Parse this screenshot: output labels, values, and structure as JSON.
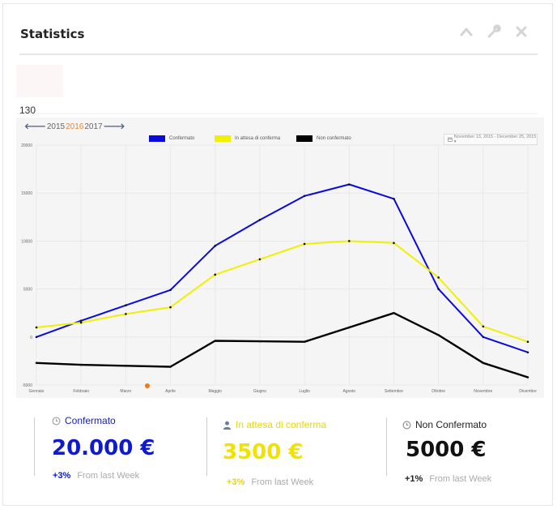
{
  "header": {
    "title": "Statistics"
  },
  "top_number": "130",
  "years": {
    "prev_arrow": "🡐",
    "y1": "2015",
    "y2": "2016",
    "y3": "2017",
    "next_arrow": "🡒"
  },
  "date_range": "November 13, 2015 - December 25, 2015 ▾",
  "legend": [
    {
      "label": "Confermato",
      "color": "#0a0adc"
    },
    {
      "label": "In attesa di conferma",
      "color": "#f0f000"
    },
    {
      "label": "Non confermato",
      "color": "#000000"
    }
  ],
  "chart_data": {
    "type": "line",
    "categories": [
      "Gennaio",
      "Febbraio",
      "Marzo",
      "Aprile",
      "Maggio",
      "Giugno",
      "Luglio",
      "Agosto",
      "Settembre",
      "Ottobre",
      "Novembre",
      "Dicembre"
    ],
    "ylim": [
      -5000,
      20000
    ],
    "y_ticks": [
      20000,
      15000,
      10000,
      5000,
      0,
      -5000
    ],
    "grid": true,
    "legend_position": "top",
    "series": [
      {
        "name": "Confermato",
        "color": "#0a0adc",
        "values": [
          0,
          1700,
          3300,
          4900,
          9500,
          12200,
          14700,
          15900,
          14400,
          5000,
          0,
          -1600
        ]
      },
      {
        "name": "In attesa di conferma",
        "color": "#f0f000",
        "values": [
          1000,
          1500,
          2400,
          3100,
          6500,
          8100,
          9700,
          10000,
          9800,
          6200,
          1100,
          -500
        ]
      },
      {
        "name": "Non confermato",
        "color": "#000000",
        "values": [
          -2700,
          -2900,
          -3000,
          -3100,
          -400,
          -450,
          -500,
          1000,
          2500,
          200,
          -2700,
          -4200
        ]
      }
    ]
  },
  "stats": [
    {
      "icon": "clock-icon",
      "label": "Confermato",
      "value": "20.000 €",
      "pct": "+3%",
      "text": "From last Week",
      "color": "#0f1ac8",
      "value_color": "#0f1ac8",
      "pct_color": "#0f1ac8"
    },
    {
      "icon": "user-icon",
      "label": "In attesa di conferma",
      "value": "3500 €",
      "pct": "+3%",
      "text": "From last Week",
      "color": "#e8d800",
      "value_color": "#f2e200",
      "pct_color": "#e8d800"
    },
    {
      "icon": "clock-icon",
      "label": "Non Confermato",
      "value": "5000 €",
      "pct": "+1%",
      "text": "From last Week",
      "color": "#222222",
      "value_color": "#111111",
      "pct_color": "#222222"
    }
  ]
}
